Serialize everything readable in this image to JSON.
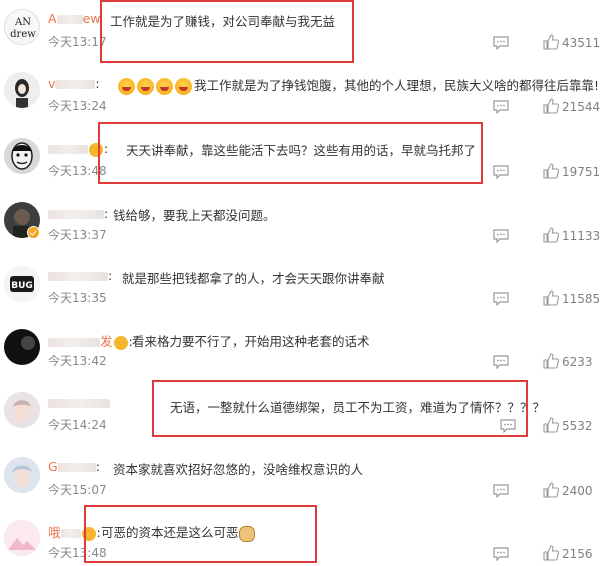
{
  "comments": [
    {
      "username_visible": "A",
      "username_tail": "ew",
      "avatar_text_line1": "AN",
      "avatar_text_line2": "drew",
      "text": "工作就是为了赚钱，对公司奉献与我无益",
      "time": "今天13:17",
      "likes": "43511",
      "highlighted": true
    },
    {
      "username_visible": "v",
      "username_tail": "",
      "text": "我工作就是为了挣钱饱腹，其他的个人理想，民族大义啥的都得往后靠靠!",
      "emojis": 4,
      "time": "今天13:24",
      "likes": "21544",
      "highlighted": false
    },
    {
      "username_visible": "",
      "username_tail": "",
      "text": "天天讲奉献，靠这些能活下去吗？这些有用的话，早就乌托邦了",
      "time": "今天13:48",
      "likes": "19751",
      "highlighted": true
    },
    {
      "username_visible": "",
      "username_tail": "",
      "text": "钱给够，要我上天都没问题。",
      "time": "今天13:37",
      "likes": "11133",
      "highlighted": false
    },
    {
      "username_visible": "",
      "username_tail": "",
      "avatar_text": "BUG",
      "text": "就是那些把钱都拿了的人，才会天天跟你讲奉献",
      "time": "今天13:35",
      "likes": "11585",
      "highlighted": false
    },
    {
      "username_visible": "",
      "username_tail": "发",
      "text": "看来格力要不行了，开始用这种老套的话术",
      "time": "今天13:42",
      "likes": "6233",
      "highlighted": false
    },
    {
      "username_visible": "",
      "username_tail": "",
      "text": "无语，一整就什么道德绑架，员工不为工资，难道为了情怀？？？？",
      "time": "今天14:24",
      "likes": "5532",
      "highlighted": true
    },
    {
      "username_visible": "G",
      "username_tail": "",
      "text": "资本家就喜欢招好忽悠的，没啥维权意识的人",
      "time": "今天15:07",
      "likes": "2400",
      "highlighted": false
    },
    {
      "username_visible": "哦",
      "username_tail": "",
      "text": "可恶的资本还是这么可恶",
      "time": "今天13:48",
      "likes": "2156",
      "highlighted": true
    }
  ],
  "colors": {
    "username": "#eb7350",
    "highlight_box": "#e03b3b",
    "muted": "#888888"
  },
  "icons": {
    "comment": "comment-bubble-icon",
    "like": "thumb-up-icon"
  }
}
